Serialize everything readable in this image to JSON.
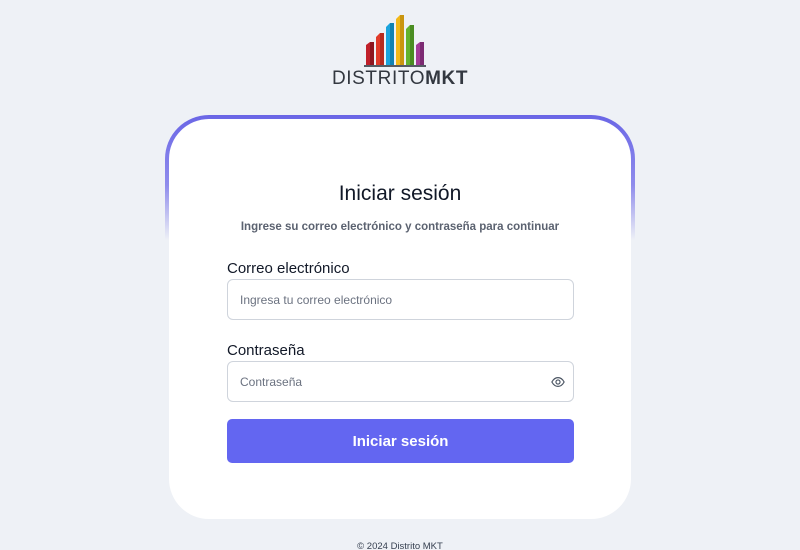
{
  "brand": {
    "name_light": "DISTRITO",
    "name_bold": "MKT",
    "logo_icon": "city-bars-logo-icon",
    "bar_colors": [
      "#c0202a",
      "#e03b2a",
      "#1aa3dc",
      "#f2b818",
      "#62b22f",
      "#a33b97"
    ]
  },
  "login": {
    "title": "Iniciar sesión",
    "subtitle": "Ingrese su correo electrónico y contraseña para continuar",
    "email_label": "Correo electrónico",
    "email_placeholder": "Ingresa tu correo electrónico",
    "email_value": "",
    "password_label": "Contraseña",
    "password_placeholder": "Contraseña",
    "password_value": "",
    "password_toggle_icon": "eye-icon",
    "submit_label": "Iniciar sesión"
  },
  "footer": {
    "copyright": "© 2024 Distrito MKT"
  },
  "colors": {
    "accent": "#6366f1",
    "background": "#eef1f6",
    "card_border_top": "#6a66e6"
  }
}
